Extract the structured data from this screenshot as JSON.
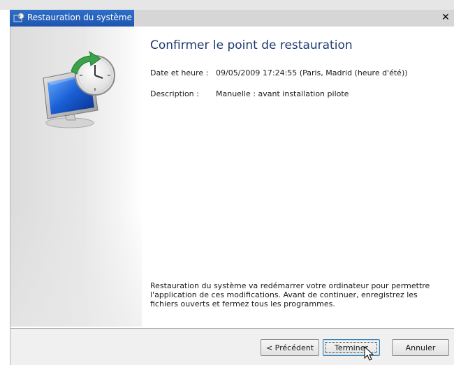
{
  "window": {
    "title": "Restauration du système",
    "close_glyph": "✕",
    "icons": {
      "title": "system-restore-icon",
      "hero": "system-restore-monitor-clock-icon"
    }
  },
  "main": {
    "heading": "Confirmer le point de restauration",
    "date_label": "Date et heure :",
    "date_value": "09/05/2009 17:24:55 (Paris, Madrid (heure d'été))",
    "desc_label": "Description :",
    "desc_value": "Manuelle : avant installation pilote",
    "notice": "Restauration du système va redémarrer votre ordinateur pour permettre l'application de ces modifications. Avant de continuer, enregistrez les fichiers ouverts et fermez tous les programmes."
  },
  "buttons": {
    "prev": "< Précédent",
    "finish": "Terminer",
    "cancel": "Annuler"
  },
  "colors": {
    "title_active": "#2f6fc9",
    "heading": "#1e3a6e",
    "finish_border": "#3c7fb1"
  }
}
